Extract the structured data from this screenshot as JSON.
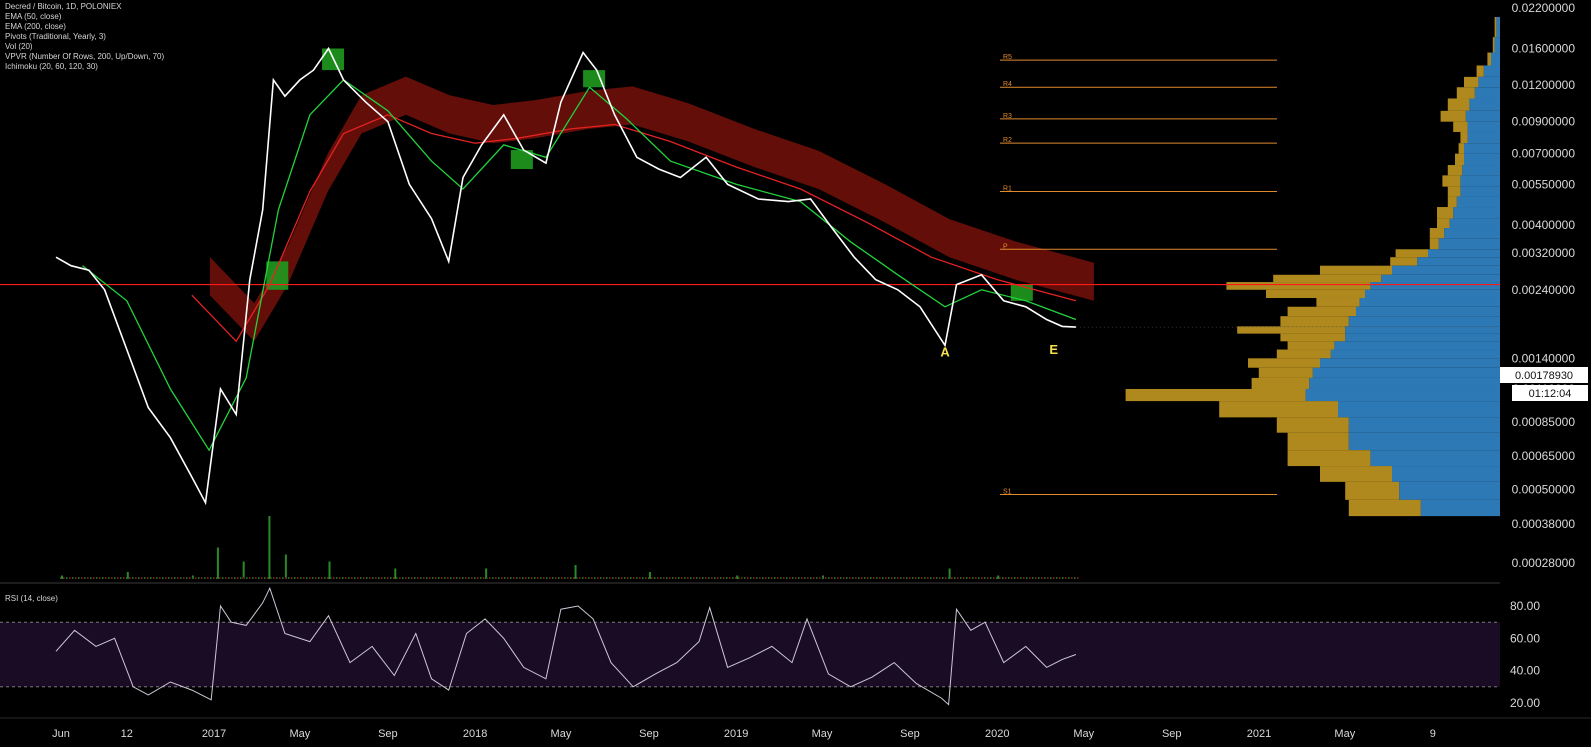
{
  "legend": {
    "symbol": "Decred / Bitcoin, 1D, POLONIEX",
    "indicators": [
      "EMA (50, close)",
      "EMA (200, close)",
      "Pivots (Traditional, Yearly, 3)",
      "Vol (20)",
      "VPVR (Number Of Rows, 200, Up/Down, 70)",
      "Ichimoku (20, 60, 120, 30)"
    ]
  },
  "rsi_title": "RSI (14, close)",
  "price_label": "0.00178930",
  "timer_label": "01:12:04",
  "colors": {
    "price": "#ffffff",
    "ema50": "#22d33c",
    "ema200": "#e52222",
    "cloud_bear": "#6e0f0a",
    "cloud_bull": "#1f9a1f",
    "pivot": "#e08a2e",
    "vpvr_up": "#2f7fbf",
    "vpvr_down": "#b8901f",
    "horizontal_line": "#ff1a1a",
    "rsi_band": "#1a0c24",
    "rsi_line": "#cfc7d8",
    "annotation": "#f5e04a"
  },
  "chart_data": [
    {
      "type": "line",
      "name": "price",
      "scale": "log",
      "y_ticks": [
        "0.02200000",
        "0.01600000",
        "0.01200000",
        "0.00900000",
        "0.00700000",
        "0.00550000",
        "0.00400000",
        "0.00320000",
        "0.00240000",
        "0.00178930",
        "0.00140000",
        "0.00110000",
        "0.00085000",
        "0.00065000",
        "0.00050000",
        "0.00038000",
        "0.00028000"
      ],
      "y_tick_values": [
        0.022,
        0.016,
        0.012,
        0.009,
        0.007,
        0.0055,
        0.004,
        0.0032,
        0.0024,
        0.0017893,
        0.0014,
        0.0011,
        0.00085,
        0.00065,
        0.0005,
        0.00038,
        0.00028
      ],
      "x_ticks": [
        "Jun",
        "12",
        "2017",
        "May",
        "Sep",
        "2018",
        "May",
        "Sep",
        "2019",
        "May",
        "Sep",
        "2020",
        "May",
        "Sep",
        "2021",
        "May",
        "9"
      ],
      "x_tick_dates": [
        "2016-06-01",
        "2016-09-01",
        "2017-01-01",
        "2017-05-01",
        "2017-09-01",
        "2018-01-01",
        "2018-05-01",
        "2018-09-01",
        "2019-01-01",
        "2019-05-01",
        "2019-09-01",
        "2020-01-01",
        "2020-05-01",
        "2020-09-01",
        "2021-01-01",
        "2021-05-01",
        "2021-09-01"
      ],
      "series": [
        {
          "points": [
            [
              "2016-05-25",
              0.0031
            ],
            [
              "2016-06-15",
              0.0029
            ],
            [
              "2016-07-10",
              0.0028
            ],
            [
              "2016-08-01",
              0.0024
            ],
            [
              "2016-09-01",
              0.0015
            ],
            [
              "2016-10-01",
              0.00095
            ],
            [
              "2016-11-01",
              0.00075
            ],
            [
              "2016-12-01",
              0.00055
            ],
            [
              "2016-12-20",
              0.00045
            ],
            [
              "2017-01-10",
              0.0011
            ],
            [
              "2017-02-01",
              0.0009
            ],
            [
              "2017-02-20",
              0.0026
            ],
            [
              "2017-03-10",
              0.0045
            ],
            [
              "2017-03-25",
              0.0125
            ],
            [
              "2017-04-10",
              0.011
            ],
            [
              "2017-05-01",
              0.0125
            ],
            [
              "2017-05-20",
              0.0135
            ],
            [
              "2017-06-10",
              0.016
            ],
            [
              "2017-07-01",
              0.0125
            ],
            [
              "2017-08-01",
              0.0105
            ],
            [
              "2017-09-01",
              0.009
            ],
            [
              "2017-10-01",
              0.0055
            ],
            [
              "2017-11-01",
              0.0042
            ],
            [
              "2017-11-25",
              0.003
            ],
            [
              "2017-12-15",
              0.0058
            ],
            [
              "2018-01-10",
              0.0075
            ],
            [
              "2018-02-10",
              0.0095
            ],
            [
              "2018-03-10",
              0.0072
            ],
            [
              "2018-04-10",
              0.0065
            ],
            [
              "2018-05-01",
              0.0105
            ],
            [
              "2018-06-01",
              0.0155
            ],
            [
              "2018-06-20",
              0.0135
            ],
            [
              "2018-07-15",
              0.0095
            ],
            [
              "2018-08-15",
              0.0068
            ],
            [
              "2018-09-15",
              0.0062
            ],
            [
              "2018-10-15",
              0.0058
            ],
            [
              "2018-11-20",
              0.0068
            ],
            [
              "2018-12-20",
              0.0055
            ],
            [
              "2019-02-01",
              0.0049
            ],
            [
              "2019-03-15",
              0.0048
            ],
            [
              "2019-04-15",
              0.0049
            ],
            [
              "2019-05-15",
              0.0039
            ],
            [
              "2019-06-15",
              0.0031
            ],
            [
              "2019-07-15",
              0.0026
            ],
            [
              "2019-08-15",
              0.0024
            ],
            [
              "2019-09-15",
              0.0021
            ],
            [
              "2019-10-20",
              0.00155
            ],
            [
              "2019-11-05",
              0.0025
            ],
            [
              "2019-12-10",
              0.0027
            ],
            [
              "2020-01-10",
              0.0022
            ],
            [
              "2020-02-10",
              0.0021
            ],
            [
              "2020-03-10",
              0.0019
            ],
            [
              "2020-04-01",
              0.0018
            ],
            [
              "2020-04-20",
              0.0017893
            ]
          ]
        }
      ],
      "ema50": [
        [
          "2016-07-01",
          0.0029
        ],
        [
          "2016-09-01",
          0.0022
        ],
        [
          "2016-11-01",
          0.0011
        ],
        [
          "2016-12-25",
          0.00068
        ],
        [
          "2017-02-15",
          0.0012
        ],
        [
          "2017-04-01",
          0.0045
        ],
        [
          "2017-05-15",
          0.0095
        ],
        [
          "2017-07-01",
          0.0125
        ],
        [
          "2017-09-01",
          0.0098
        ],
        [
          "2017-11-01",
          0.0066
        ],
        [
          "2017-12-15",
          0.0053
        ],
        [
          "2018-02-10",
          0.0075
        ],
        [
          "2018-04-10",
          0.0068
        ],
        [
          "2018-06-10",
          0.0118
        ],
        [
          "2018-08-01",
          0.0092
        ],
        [
          "2018-10-01",
          0.0066
        ],
        [
          "2019-01-01",
          0.0055
        ],
        [
          "2019-04-01",
          0.0048
        ],
        [
          "2019-06-10",
          0.0035
        ],
        [
          "2019-08-15",
          0.0027
        ],
        [
          "2019-10-20",
          0.0021
        ],
        [
          "2019-12-10",
          0.0024
        ],
        [
          "2020-02-10",
          0.0022
        ],
        [
          "2020-04-20",
          0.0019
        ]
      ],
      "ema200": [
        [
          "2016-12-01",
          0.0023
        ],
        [
          "2017-02-01",
          0.0016
        ],
        [
          "2017-03-20",
          0.0025
        ],
        [
          "2017-05-15",
          0.0052
        ],
        [
          "2017-07-01",
          0.0082
        ],
        [
          "2017-09-01",
          0.0095
        ],
        [
          "2017-11-01",
          0.0082
        ],
        [
          "2018-01-01",
          0.0076
        ],
        [
          "2018-03-01",
          0.0079
        ],
        [
          "2018-05-15",
          0.0085
        ],
        [
          "2018-07-15",
          0.0088
        ],
        [
          "2018-10-01",
          0.0077
        ],
        [
          "2019-01-01",
          0.0063
        ],
        [
          "2019-04-01",
          0.0053
        ],
        [
          "2019-07-01",
          0.0041
        ],
        [
          "2019-10-01",
          0.0031
        ],
        [
          "2020-01-01",
          0.0026
        ],
        [
          "2020-04-20",
          0.0022
        ]
      ],
      "pivots": [
        {
          "label": "R5",
          "value": 0.0146
        },
        {
          "label": "R4",
          "value": 0.0118
        },
        {
          "label": "R3",
          "value": 0.0092
        },
        {
          "label": "R2",
          "value": 0.0076
        },
        {
          "label": "R1",
          "value": 0.0052
        },
        {
          "label": "P",
          "value": 0.0033
        },
        {
          "label": "S1",
          "value": 0.00048
        }
      ],
      "horizontal_line": 0.0025,
      "annotations": [
        {
          "label": "A",
          "date": "2019-10-20",
          "value": 0.00142
        },
        {
          "label": "E",
          "date": "2020-03-20",
          "value": 0.00145
        }
      ]
    },
    {
      "type": "line",
      "name": "RSI",
      "y_ticks": [
        "80.00",
        "60.00",
        "40.00",
        "20.00"
      ],
      "y_tick_values": [
        80,
        60,
        40,
        20
      ],
      "ylim": [
        15,
        92
      ],
      "bands": [
        30,
        70
      ],
      "points": [
        [
          "2016-05-25",
          52
        ],
        [
          "2016-06-20",
          65
        ],
        [
          "2016-07-20",
          55
        ],
        [
          "2016-08-15",
          60
        ],
        [
          "2016-09-10",
          30
        ],
        [
          "2016-10-01",
          25
        ],
        [
          "2016-11-01",
          33
        ],
        [
          "2016-12-01",
          28
        ],
        [
          "2016-12-28",
          22
        ],
        [
          "2017-01-10",
          80
        ],
        [
          "2017-01-25",
          70
        ],
        [
          "2017-02-15",
          68
        ],
        [
          "2017-03-10",
          82
        ],
        [
          "2017-03-20",
          91
        ],
        [
          "2017-04-10",
          63
        ],
        [
          "2017-05-15",
          58
        ],
        [
          "2017-06-10",
          74
        ],
        [
          "2017-07-10",
          45
        ],
        [
          "2017-08-10",
          55
        ],
        [
          "2017-09-10",
          37
        ],
        [
          "2017-10-10",
          63
        ],
        [
          "2017-11-01",
          35
        ],
        [
          "2017-11-25",
          28
        ],
        [
          "2017-12-20",
          63
        ],
        [
          "2018-01-15",
          72
        ],
        [
          "2018-02-10",
          60
        ],
        [
          "2018-03-10",
          42
        ],
        [
          "2018-04-10",
          35
        ],
        [
          "2018-05-01",
          78
        ],
        [
          "2018-05-25",
          80
        ],
        [
          "2018-06-15",
          72
        ],
        [
          "2018-07-10",
          45
        ],
        [
          "2018-08-10",
          30
        ],
        [
          "2018-09-10",
          38
        ],
        [
          "2018-10-10",
          45
        ],
        [
          "2018-11-10",
          58
        ],
        [
          "2018-11-25",
          79
        ],
        [
          "2018-12-20",
          42
        ],
        [
          "2019-01-20",
          48
        ],
        [
          "2019-02-20",
          55
        ],
        [
          "2019-03-20",
          45
        ],
        [
          "2019-04-10",
          72
        ],
        [
          "2019-05-10",
          38
        ],
        [
          "2019-06-10",
          30
        ],
        [
          "2019-07-10",
          36
        ],
        [
          "2019-08-10",
          45
        ],
        [
          "2019-09-10",
          32
        ],
        [
          "2019-10-15",
          23
        ],
        [
          "2019-10-25",
          19
        ],
        [
          "2019-11-05",
          78
        ],
        [
          "2019-11-25",
          65
        ],
        [
          "2019-12-15",
          70
        ],
        [
          "2020-01-10",
          45
        ],
        [
          "2020-02-10",
          55
        ],
        [
          "2020-03-10",
          42
        ],
        [
          "2020-04-01",
          47
        ],
        [
          "2020-04-20",
          50
        ]
      ]
    },
    {
      "type": "bar",
      "name": "Vol (20)",
      "points": [
        [
          "2016-06-01",
          1
        ],
        [
          "2016-09-01",
          2
        ],
        [
          "2016-12-01",
          1
        ],
        [
          "2017-01-05",
          9
        ],
        [
          "2017-02-10",
          5
        ],
        [
          "2017-03-18",
          18
        ],
        [
          "2017-04-10",
          7
        ],
        [
          "2017-06-10",
          5
        ],
        [
          "2017-09-10",
          3
        ],
        [
          "2018-01-15",
          3
        ],
        [
          "2018-05-20",
          4
        ],
        [
          "2018-09-01",
          2
        ],
        [
          "2019-01-01",
          1
        ],
        [
          "2019-05-01",
          1
        ],
        [
          "2019-10-25",
          3
        ],
        [
          "2020-01-01",
          1
        ]
      ]
    },
    {
      "type": "bar",
      "name": "VPVR",
      "orientation": "horizontal",
      "rows": [
        {
          "price": 0.0205,
          "up": 2,
          "down": 1
        },
        {
          "price": 0.0175,
          "up": 3,
          "down": 1
        },
        {
          "price": 0.0155,
          "up": 5,
          "down": 2
        },
        {
          "price": 0.014,
          "up": 9,
          "down": 4
        },
        {
          "price": 0.0128,
          "up": 12,
          "down": 8
        },
        {
          "price": 0.0118,
          "up": 14,
          "down": 10
        },
        {
          "price": 0.0108,
          "up": 17,
          "down": 12
        },
        {
          "price": 0.0098,
          "up": 19,
          "down": 14
        },
        {
          "price": 0.009,
          "up": 18,
          "down": 8
        },
        {
          "price": 0.0083,
          "up": 18,
          "down": 4
        },
        {
          "price": 0.0076,
          "up": 20,
          "down": 3
        },
        {
          "price": 0.007,
          "up": 20,
          "down": 5
        },
        {
          "price": 0.0064,
          "up": 21,
          "down": 8
        },
        {
          "price": 0.0059,
          "up": 22,
          "down": 10
        },
        {
          "price": 0.0054,
          "up": 22,
          "down": 7
        },
        {
          "price": 0.005,
          "up": 24,
          "down": 5
        },
        {
          "price": 0.0046,
          "up": 26,
          "down": 9
        },
        {
          "price": 0.0042,
          "up": 28,
          "down": 7
        },
        {
          "price": 0.0039,
          "up": 31,
          "down": 8
        },
        {
          "price": 0.0036,
          "up": 34,
          "down": 5
        },
        {
          "price": 0.0033,
          "up": 40,
          "down": 18
        },
        {
          "price": 0.0031,
          "up": 46,
          "down": 15
        },
        {
          "price": 0.0029,
          "up": 60,
          "down": 40
        },
        {
          "price": 0.0027,
          "up": 66,
          "down": 60
        },
        {
          "price": 0.00255,
          "up": 72,
          "down": 80
        },
        {
          "price": 0.0024,
          "up": 75,
          "down": 55
        },
        {
          "price": 0.00225,
          "up": 78,
          "down": 24
        },
        {
          "price": 0.0021,
          "up": 80,
          "down": 38
        },
        {
          "price": 0.00195,
          "up": 84,
          "down": 38
        },
        {
          "price": 0.0018,
          "up": 86,
          "down": 60
        },
        {
          "price": 0.0017,
          "up": 86,
          "down": 36
        },
        {
          "price": 0.0016,
          "up": 92,
          "down": 26
        },
        {
          "price": 0.0015,
          "up": 94,
          "down": 30
        },
        {
          "price": 0.0014,
          "up": 100,
          "down": 40
        },
        {
          "price": 0.0013,
          "up": 104,
          "down": 30
        },
        {
          "price": 0.0012,
          "up": 106,
          "down": 32
        },
        {
          "price": 0.0011,
          "up": 108,
          "down": 100
        },
        {
          "price": 0.001,
          "up": 90,
          "down": 66
        },
        {
          "price": 0.00088,
          "up": 84,
          "down": 40
        },
        {
          "price": 0.00078,
          "up": 84,
          "down": 34
        },
        {
          "price": 0.00068,
          "up": 72,
          "down": 46
        },
        {
          "price": 0.0006,
          "up": 60,
          "down": 40
        },
        {
          "price": 0.00053,
          "up": 56,
          "down": 30
        },
        {
          "price": 0.00046,
          "up": 44,
          "down": 40
        }
      ]
    }
  ]
}
